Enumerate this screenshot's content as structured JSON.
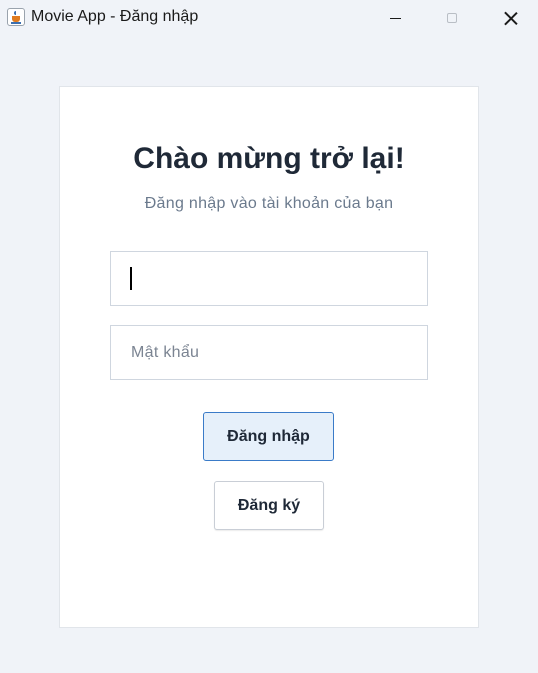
{
  "window": {
    "title": "Movie App - Đăng nhập"
  },
  "login": {
    "heading": "Chào mừng trở lại!",
    "subheading": "Đăng nhập vào tài khoản của bạn",
    "username_value": "",
    "password_placeholder": "Mật khẩu",
    "login_label": "Đăng nhập",
    "register_label": "Đăng ký"
  },
  "colors": {
    "background": "#f0f3f8",
    "card": "#ffffff",
    "heading_text": "#1f2937",
    "subtext": "#6b7a8d",
    "login_button_border": "#3a7bc8",
    "login_button_fill": "#e6f0fa"
  },
  "icons": {
    "app": "java-app-icon",
    "minimize": "minimize-icon",
    "maximize": "maximize-icon",
    "close": "close-icon"
  }
}
